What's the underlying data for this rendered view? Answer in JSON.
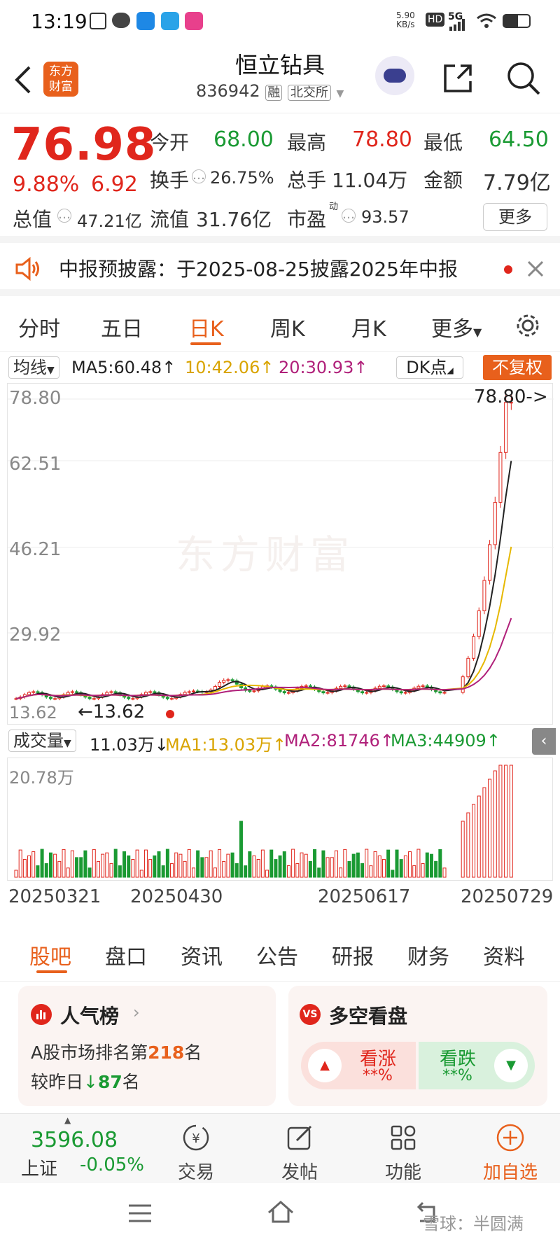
{
  "status_bar": {
    "time": "13:19",
    "net_speed": "5.90",
    "net_unit": "KB/s",
    "hd": "HD",
    "network": "5G"
  },
  "header": {
    "logo_line1": "东方",
    "logo_line2": "财富",
    "title": "恒立钻具",
    "code": "836942",
    "tag_margin": "融",
    "tag_exchange": "北交所"
  },
  "quote": {
    "price": "76.98",
    "change_pct": "9.88%",
    "change": "6.92",
    "row1": [
      {
        "label": "今开",
        "value": "68.00",
        "color": "green"
      },
      {
        "label": "最高",
        "value": "78.80",
        "color": "red"
      },
      {
        "label": "最低",
        "value": "64.50",
        "color": "green"
      }
    ],
    "turnover_label": "换手",
    "turnover": "26.75%",
    "volume_label": "总手",
    "volume": "11.04万",
    "amount_label": "金额",
    "amount": "7.79亿",
    "mktcap_label": "总值",
    "mktcap": "47.21亿",
    "float_label": "流值",
    "float_cap": "31.76亿",
    "pe_label": "市盈",
    "pe_sup": "动",
    "pe": "93.57",
    "more": "更多"
  },
  "notice": {
    "text": "中报预披露：于2025-08-25披露2025年中报"
  },
  "kline_tabs": [
    "分时",
    "五日",
    "日K",
    "周K",
    "月K",
    "更多"
  ],
  "kline_active": 2,
  "ma_bar": {
    "selector": "均线",
    "ma5": "MA5:60.48↑",
    "ma10": "10:42.06↑",
    "ma20": "20:30.93↑",
    "dk": "DK点",
    "adjust": "不复权"
  },
  "price_axis": [
    "78.80",
    "62.51",
    "46.21",
    "29.92"
  ],
  "high_marker": "78.80->",
  "low_label": "13.62",
  "low_marker": "←13.62",
  "vol_bar": {
    "selector": "成交量",
    "vol": "11.03万↓",
    "ma1": "MA1:13.03万↑",
    "ma2": "MA2:81746↑",
    "ma3": "MA3:44909↑"
  },
  "vol_axis_top": "20.78万",
  "dates": [
    "20250321",
    "20250430",
    "20250617",
    "20250729"
  ],
  "section_tabs": [
    "股吧",
    "盘口",
    "资讯",
    "公告",
    "研报",
    "财务",
    "资料"
  ],
  "section_active": 0,
  "popularity": {
    "title": "人气榜",
    "line1_pre": "A股市场排名第",
    "rank": "218",
    "line1_post": "名",
    "line2_pre": "较昨日",
    "delta": "87",
    "line2_post": "名"
  },
  "sentiment": {
    "badge": "VS",
    "title": "多空看盘",
    "up_label": "看涨",
    "up_value": "**%",
    "down_label": "看跌",
    "down_value": "**%"
  },
  "index": {
    "value": "3596.08",
    "name": "上证",
    "change": "-0.05%"
  },
  "bottom_actions": [
    "交易",
    "发帖",
    "功能",
    "加自选"
  ],
  "watermark": "雪球：半圆满",
  "colors": {
    "red": "#e0261c",
    "green": "#1a9a33",
    "accent": "#e8601c",
    "ma5": "#222222",
    "ma10": "#e6b800",
    "ma20": "#b0207a"
  }
}
